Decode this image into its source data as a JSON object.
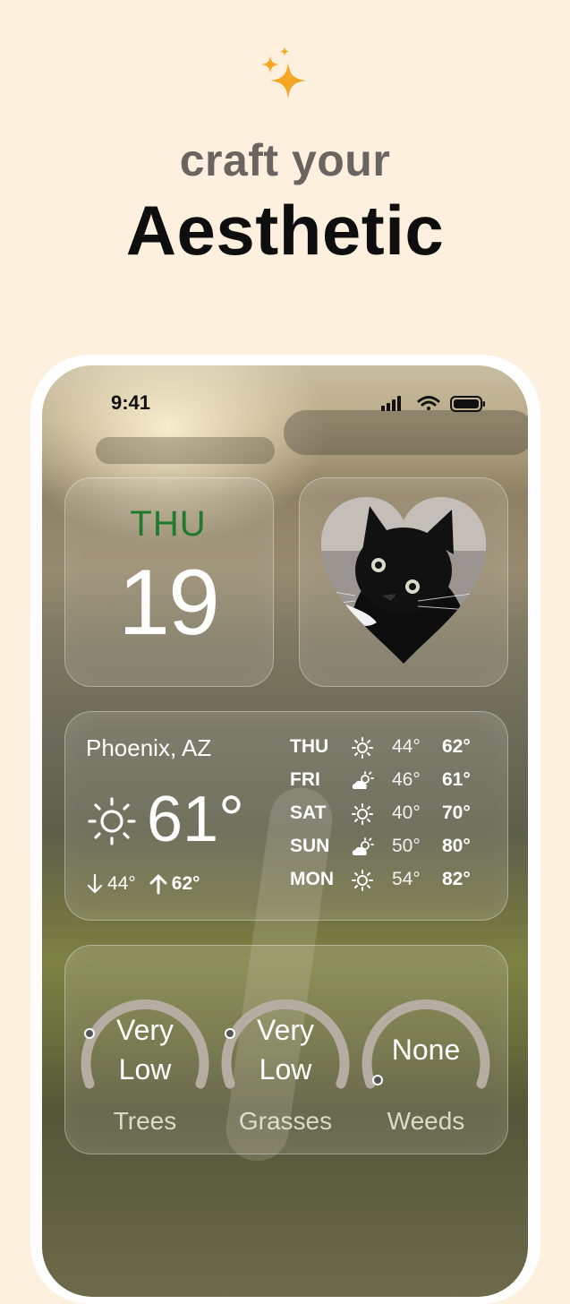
{
  "header": {
    "subtitle": "craft your",
    "title": "Aesthetic",
    "sparkle_icon": "sparkles-icon",
    "sparkle_color": "#f5a623"
  },
  "status_bar": {
    "time": "9:41",
    "icons": [
      "signal-icon",
      "wifi-icon",
      "battery-icon"
    ]
  },
  "date_widget": {
    "day": "THU",
    "date": "19",
    "day_color": "#1f7a2e"
  },
  "photo_widget": {
    "shape": "heart",
    "subject": "cat-photo"
  },
  "weather_widget": {
    "city": "Phoenix, AZ",
    "current_temp": "61°",
    "current_icon": "sun-icon",
    "low": "44°",
    "high": "62°",
    "forecast": [
      {
        "day": "THU",
        "icon": "sun-icon",
        "low": "44°",
        "high": "62°"
      },
      {
        "day": "FRI",
        "icon": "partly-cloudy-icon",
        "low": "46°",
        "high": "61°"
      },
      {
        "day": "SAT",
        "icon": "sun-icon",
        "low": "40°",
        "high": "70°"
      },
      {
        "day": "SUN",
        "icon": "partly-cloudy-icon",
        "low": "50°",
        "high": "80°"
      },
      {
        "day": "MON",
        "icon": "sun-icon",
        "low": "54°",
        "high": "82°"
      }
    ]
  },
  "pollen_widget": {
    "items": [
      {
        "line1": "Very",
        "line2": "Low",
        "label": "Trees",
        "level": 0.05
      },
      {
        "line1": "Very",
        "line2": "Low",
        "label": "Grasses",
        "level": 0.05
      },
      {
        "line1": "None",
        "line2": "",
        "label": "Weeds",
        "level": 0.0
      }
    ]
  }
}
